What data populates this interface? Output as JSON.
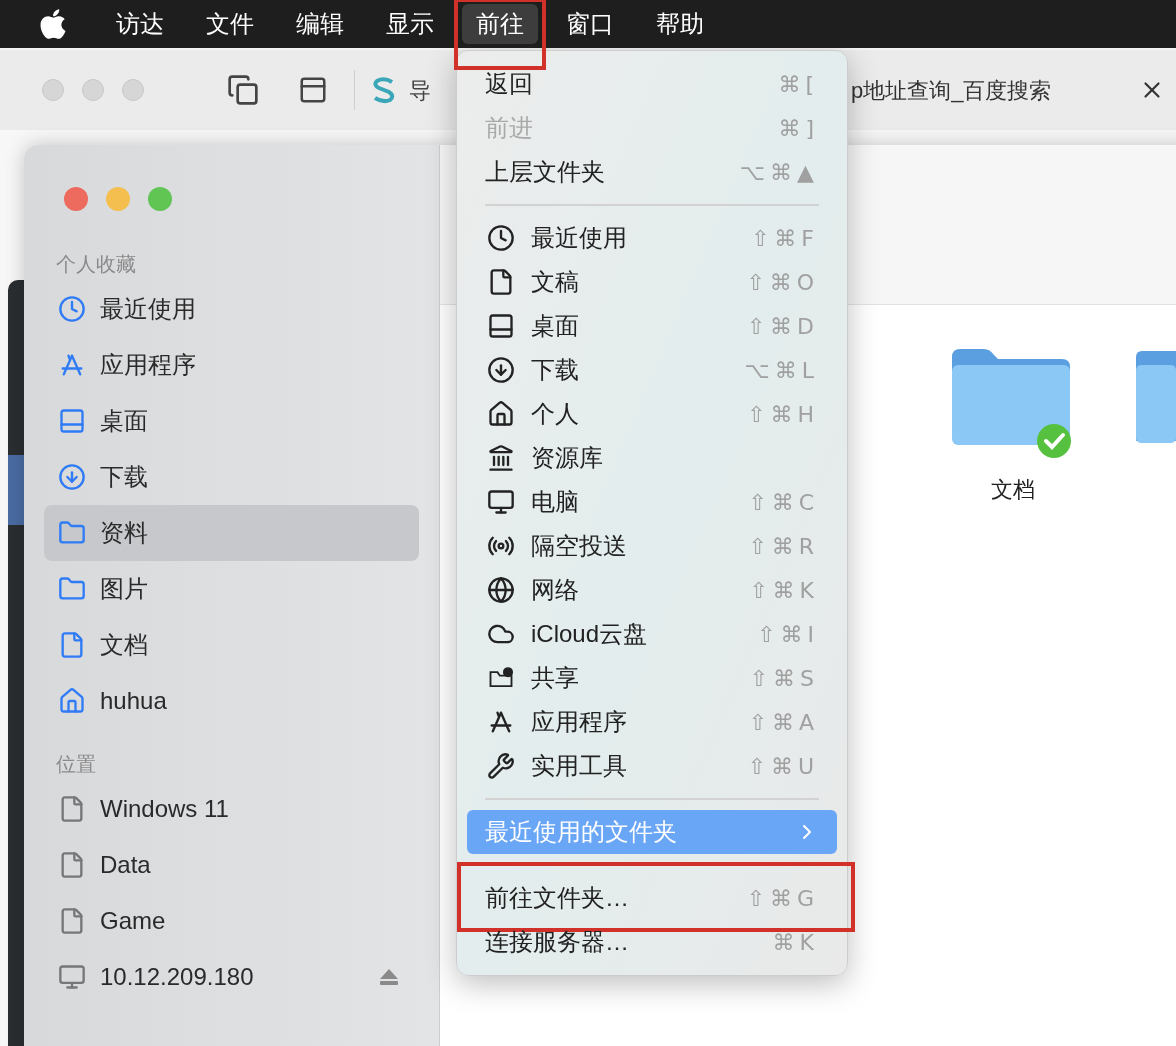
{
  "menu_bar": {
    "items": [
      {
        "label": "访达",
        "selected": false,
        "outlined": false
      },
      {
        "label": "文件",
        "selected": false,
        "outlined": false
      },
      {
        "label": "编辑",
        "selected": false,
        "outlined": false
      },
      {
        "label": "显示",
        "selected": false,
        "outlined": false
      },
      {
        "label": "前往",
        "selected": true,
        "outlined": true
      },
      {
        "label": "窗口",
        "selected": false,
        "outlined": false
      },
      {
        "label": "帮助",
        "selected": false,
        "outlined": false
      }
    ]
  },
  "browser": {
    "tabs": [
      {
        "title": "导"
      },
      {
        "title": "p地址查询_百度搜索"
      }
    ]
  },
  "finder": {
    "sidebar": {
      "sections": [
        {
          "title": "个人收藏",
          "items": [
            {
              "label": "最近使用",
              "selected": false
            },
            {
              "label": "应用程序",
              "selected": false
            },
            {
              "label": "桌面",
              "selected": false
            },
            {
              "label": "下载",
              "selected": false
            },
            {
              "label": "资料",
              "selected": true
            },
            {
              "label": "图片",
              "selected": false
            },
            {
              "label": "文档",
              "selected": false
            },
            {
              "label": "huhua",
              "selected": false
            }
          ]
        },
        {
          "title": "位置",
          "items": [
            {
              "label": "Windows 11",
              "selected": false,
              "ejectable": false
            },
            {
              "label": "Data",
              "selected": false,
              "ejectable": false
            },
            {
              "label": "Game",
              "selected": false,
              "ejectable": false
            },
            {
              "label": "10.12.209.180",
              "selected": false,
              "ejectable": true
            }
          ]
        }
      ]
    },
    "files": [
      {
        "name": "文档",
        "synced": true
      }
    ]
  },
  "menu": {
    "groups": [
      {
        "kind": "nav",
        "items": [
          {
            "label": "返回",
            "shortcut": "⌘[",
            "disabled": false,
            "selected": false,
            "outlined": false,
            "submenu": false
          },
          {
            "label": "前进",
            "shortcut": "⌘]",
            "disabled": true,
            "selected": false,
            "outlined": false,
            "submenu": false
          },
          {
            "label": "上层文件夹",
            "shortcut": "⌥⌘▲",
            "disabled": false,
            "selected": false,
            "outlined": false,
            "submenu": false
          }
        ]
      },
      {
        "kind": "places",
        "items": [
          {
            "label": "最近使用",
            "shortcut": "⇧⌘F",
            "disabled": false,
            "selected": false,
            "outlined": false,
            "submenu": false
          },
          {
            "label": "文稿",
            "shortcut": "⇧⌘O",
            "disabled": false,
            "selected": false,
            "outlined": false,
            "submenu": false
          },
          {
            "label": "桌面",
            "shortcut": "⇧⌘D",
            "disabled": false,
            "selected": false,
            "outlined": false,
            "submenu": false
          },
          {
            "label": "下载",
            "shortcut": "⌥⌘L",
            "disabled": false,
            "selected": false,
            "outlined": false,
            "submenu": false
          },
          {
            "label": "个人",
            "shortcut": "⇧⌘H",
            "disabled": false,
            "selected": false,
            "outlined": false,
            "submenu": false
          },
          {
            "label": "资源库",
            "disabled": false,
            "selected": false,
            "outlined": false,
            "submenu": false
          },
          {
            "label": "电脑",
            "shortcut": "⇧⌘C",
            "disabled": false,
            "selected": false,
            "outlined": false,
            "submenu": false
          },
          {
            "label": "隔空投送",
            "shortcut": "⇧⌘R",
            "disabled": false,
            "selected": false,
            "outlined": false,
            "submenu": false
          },
          {
            "label": "网络",
            "shortcut": "⇧⌘K",
            "disabled": false,
            "selected": false,
            "outlined": false,
            "submenu": false
          },
          {
            "label": "iCloud云盘",
            "shortcut": "⇧⌘I",
            "disabled": false,
            "selected": false,
            "outlined": false,
            "submenu": false
          },
          {
            "label": "共享",
            "shortcut": "⇧⌘S",
            "disabled": false,
            "selected": false,
            "outlined": false,
            "submenu": false
          },
          {
            "label": "应用程序",
            "shortcut": "⇧⌘A",
            "disabled": false,
            "selected": false,
            "outlined": false,
            "submenu": false
          },
          {
            "label": "实用工具",
            "shortcut": "⇧⌘U",
            "disabled": false,
            "selected": false,
            "outlined": false,
            "submenu": false
          }
        ]
      },
      {
        "kind": "nav",
        "items": [
          {
            "label": "最近使用的文件夹",
            "disabled": false,
            "selected": true,
            "outlined": false,
            "submenu": true
          }
        ]
      },
      {
        "kind": "nav",
        "items": [
          {
            "label": "前往文件夹…",
            "shortcut": "⇧⌘G",
            "disabled": false,
            "selected": false,
            "outlined": true,
            "submenu": false
          },
          {
            "label": "连接服务器…",
            "shortcut": "⌘K",
            "disabled": false,
            "selected": false,
            "outlined": false,
            "submenu": false
          }
        ]
      }
    ]
  }
}
